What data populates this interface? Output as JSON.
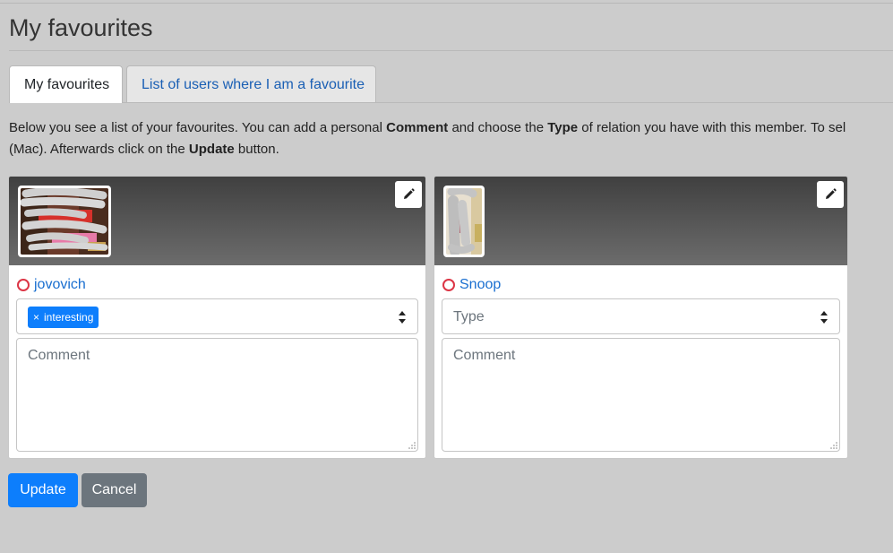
{
  "page": {
    "title": "My favourites"
  },
  "tabs": [
    {
      "label": "My favourites",
      "active": true
    },
    {
      "label": "List of users where I am a favourite",
      "active": false
    }
  ],
  "intro": {
    "p1": "Below you see a list of your favourites. You can add a personal ",
    "b1": "Comment",
    "p2": " and choose the ",
    "b2": "Type",
    "p3": " of relation you have with this member. To sel",
    "p4": "(Mac). Afterwards click on the ",
    "b3": "Update",
    "p5": " button."
  },
  "favourites": [
    {
      "username": "jovovich",
      "status_color": "#dc3545",
      "selected_types": [
        {
          "remove": "×",
          "label": "interesting"
        }
      ],
      "type_placeholder": "",
      "comment_placeholder": "Comment",
      "comment_value": ""
    },
    {
      "username": "Snoop",
      "status_color": "#dc3545",
      "selected_types": [],
      "type_placeholder": "Type",
      "comment_placeholder": "Comment",
      "comment_value": ""
    }
  ],
  "icons": {
    "edit": "pencil-icon",
    "select": "sort-arrows-icon",
    "status": "status-ring-icon"
  },
  "actions": {
    "update_label": "Update",
    "cancel_label": "Cancel"
  },
  "colors": {
    "primary": "#0d7efc",
    "secondary": "#6c757d",
    "link": "#1a6fd0",
    "offline": "#dc3545"
  }
}
